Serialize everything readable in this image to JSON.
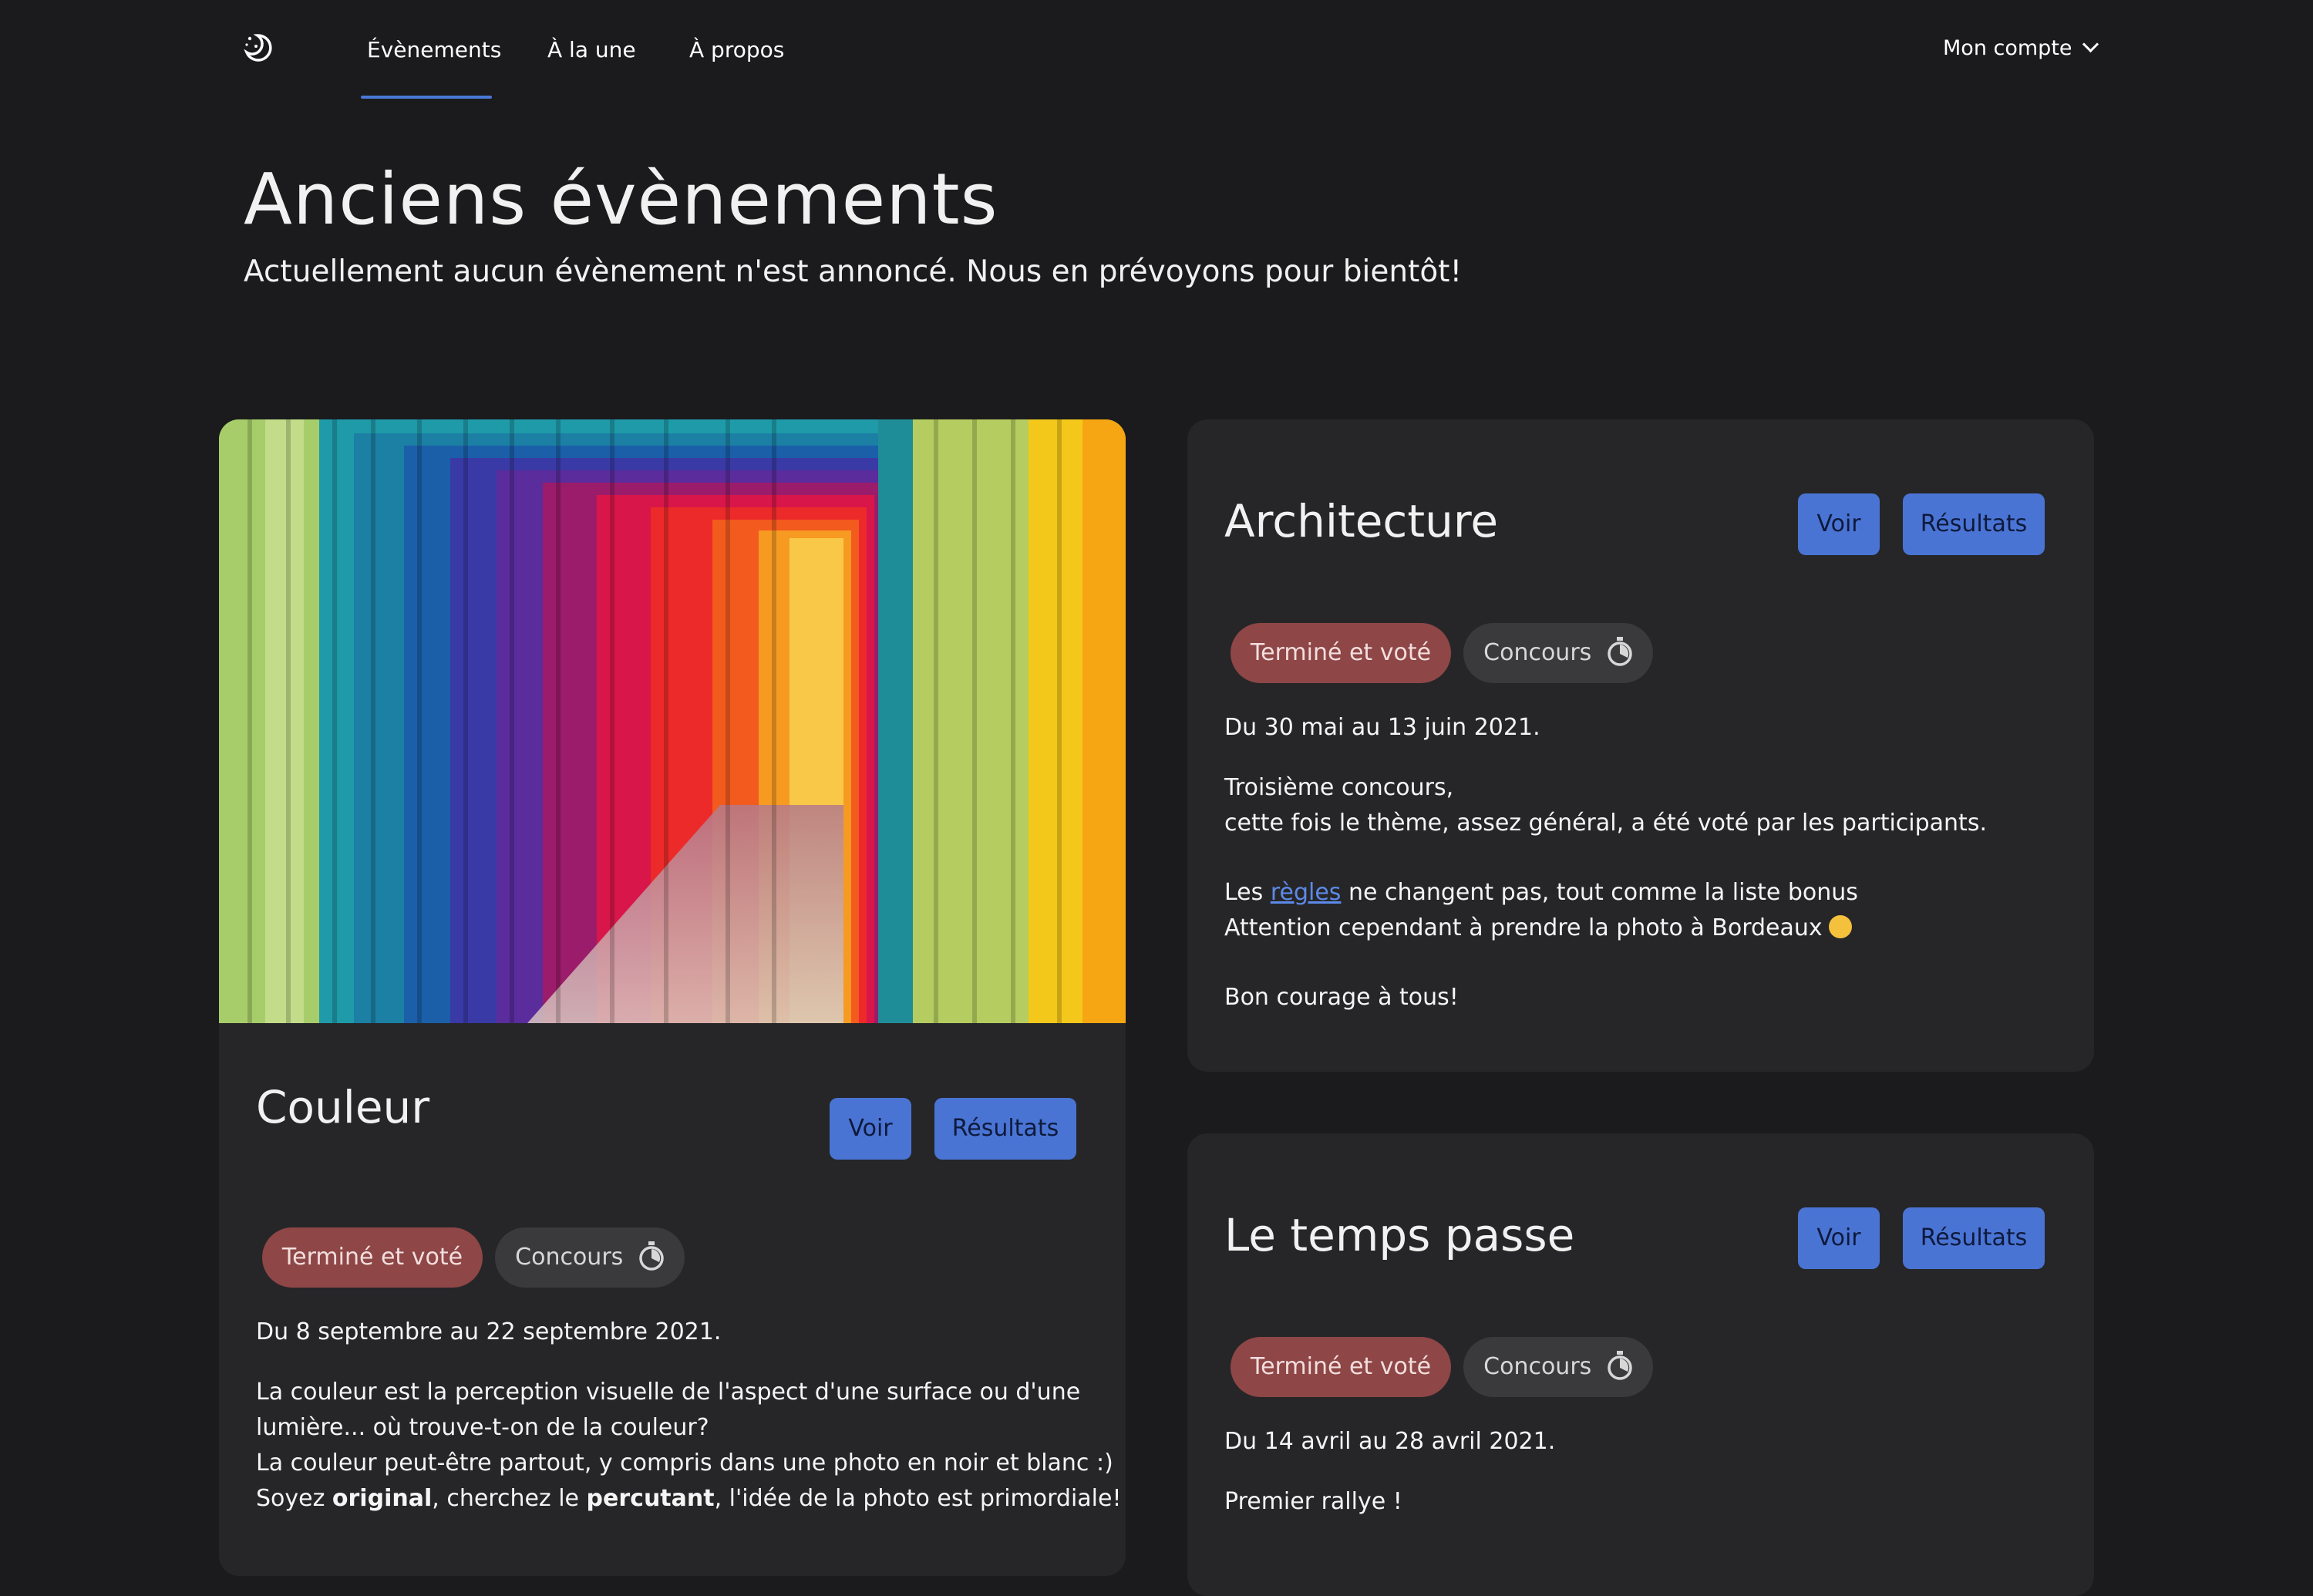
{
  "nav": {
    "items": [
      "Évènements",
      "À la une",
      "À propos"
    ],
    "account_label": "Mon compte"
  },
  "header": {
    "title": "Anciens évènements",
    "subtitle": "Actuellement aucun évènement n'est annoncé. Nous en prévoyons pour bientôt!"
  },
  "cards": [
    {
      "title": "Couleur",
      "view_label": "Voir",
      "results_label": "Résultats",
      "status_badge": "Terminé et voté",
      "type_badge": "Concours",
      "dates": "Du 8 septembre au 22 septembre 2021.",
      "desc_line1": "La couleur est la perception visuelle de l'aspect d'une surface ou d'une",
      "desc_line2": "lumière... où trouve-t-on de la couleur?",
      "desc_line3": "La couleur peut-être partout, y compris dans une photo en noir et blanc :)",
      "desc_line4_a": "Soyez ",
      "desc_line4_b": "original",
      "desc_line4_c": ", cherchez le ",
      "desc_line4_d": "percutant",
      "desc_line4_e": ", l'idée de la photo est primordiale!"
    },
    {
      "title": "Architecture",
      "view_label": "Voir",
      "results_label": "Résultats",
      "status_badge": "Terminé et voté",
      "type_badge": "Concours",
      "dates": "Du 30 mai au 13 juin 2021.",
      "desc_line1": "Troisième concours,",
      "desc_line2": "cette fois le thème, assez général, a été voté par les participants.",
      "desc_line3_a": "Les ",
      "desc_line3_link": "règles",
      "desc_line3_b": " ne changent pas, tout comme la liste bonus",
      "desc_line4": "Attention cependant à prendre la photo à Bordeaux",
      "desc_line5": "Bon courage à tous!"
    },
    {
      "title": "Le temps passe",
      "view_label": "Voir",
      "results_label": "Résultats",
      "status_badge": "Terminé et voté",
      "type_badge": "Concours",
      "dates": "Du 14 avril au 28 avril 2021.",
      "desc_line1": "Premier rallye !"
    }
  ],
  "colors": {
    "background": "#1b1b1d",
    "card": "#262628",
    "accent": "#4a74d4",
    "status_done": "#8e4646",
    "badge_neutral": "#3a3a3c"
  }
}
